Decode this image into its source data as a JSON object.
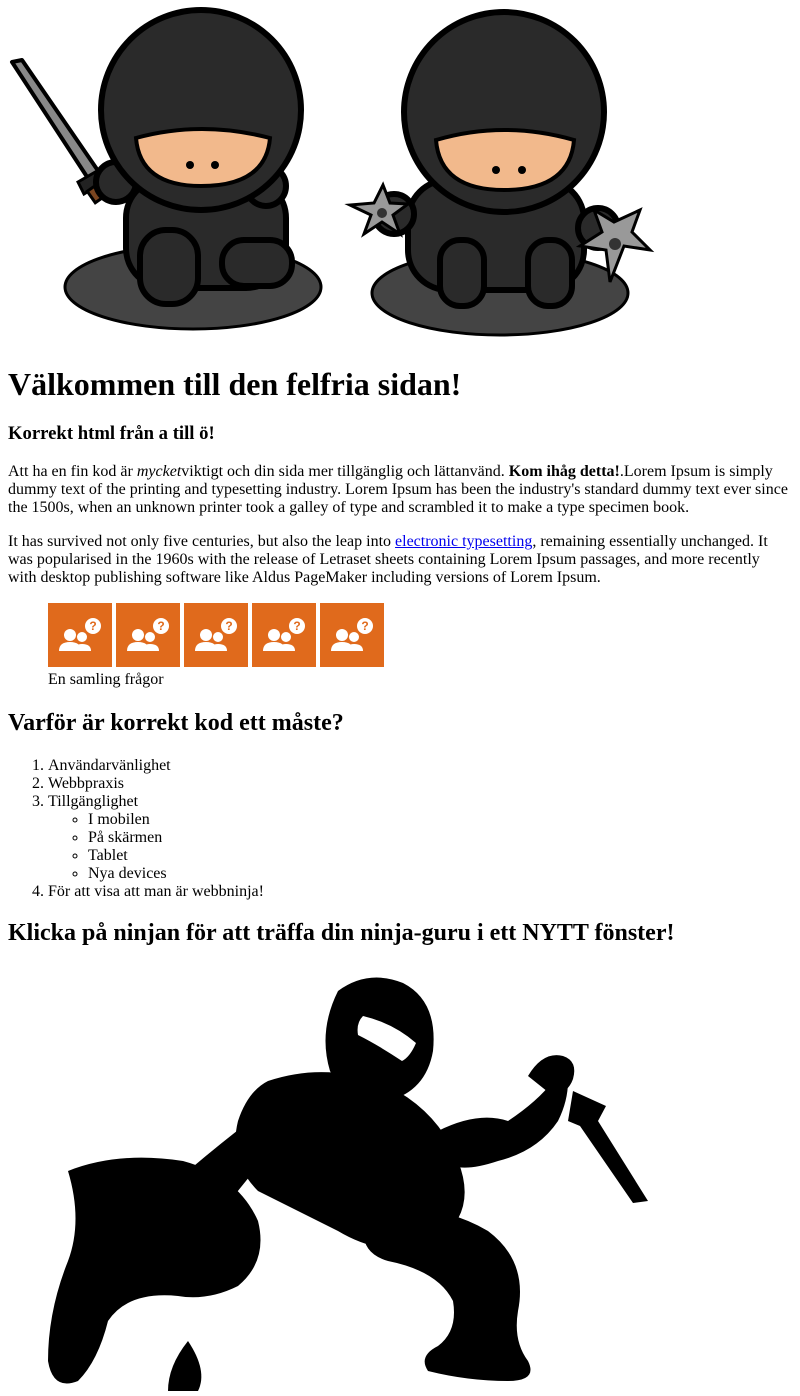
{
  "hero": {
    "icons": [
      "ninja-with-sword-icon",
      "ninja-with-shuriken-icon"
    ]
  },
  "main": {
    "title": "Välkommen till den felfria sidan!",
    "subtitle": "Korrekt html från a till ö!",
    "p1": {
      "start": "Att ha en fin kod är ",
      "em": "mycket",
      "middle": "viktigt och din sida mer tillgänglig och lättanvänd. ",
      "strong": "Kom ihåg detta!",
      "end": ".Lorem Ipsum is simply dummy text of the printing and typesetting industry. Lorem Ipsum has been the industry's standard dummy text ever since the 1500s, when an unknown printer took a galley of type and scrambled it to make a type specimen book."
    },
    "p2": {
      "start": "It has survived not only five centuries, but also the leap into ",
      "link": "electronic typesetting",
      "end": ", remaining essentially unchanged. It was popularised in the 1960s with the release of Letraset sheets containing Lorem Ipsum passages, and more recently with desktop publishing software like Aldus PageMaker including versions of Lorem Ipsum."
    }
  },
  "figure": {
    "caption": "En samling frågor",
    "tile_color": "#e06a1c",
    "tile_icon": "people-question-icon"
  },
  "why": {
    "heading": "Varför är korrekt kod ett måste?",
    "items": [
      "Användarvänlighet",
      "Webbpraxis",
      "Tillgänglighet",
      "För att visa att man är webbninja!"
    ],
    "subitems": [
      "I mobilen",
      "På skärmen",
      "Tablet",
      "Nya devices"
    ]
  },
  "guru": {
    "heading": "Klicka på ninjan för att träffa din ninja-guru i ett NYTT fönster!",
    "icon": "crouching-ninja-silhouette-icon"
  }
}
